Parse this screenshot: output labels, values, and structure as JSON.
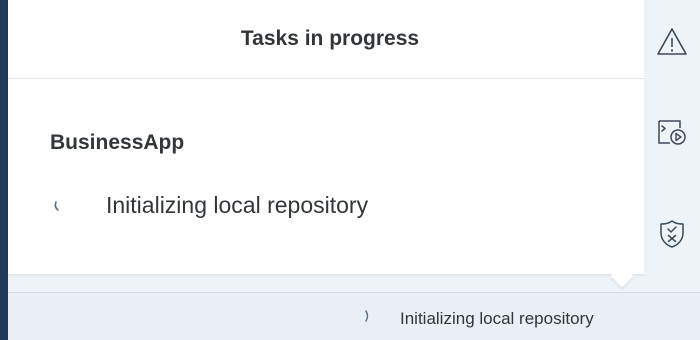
{
  "popover": {
    "title": "Tasks in progress",
    "app_name": "BusinessApp",
    "task_text": "Initializing local repository"
  },
  "status_bar": {
    "text": "Initializing local repository"
  },
  "right_rail": {
    "buttons": [
      {
        "icon": "warning-icon"
      },
      {
        "icon": "terminal-run-icon"
      },
      {
        "icon": "shield-check-icon"
      }
    ]
  },
  "colors": {
    "text": "#32363a",
    "rail_bg": "#eef3f8",
    "status_bg": "#e9eff5",
    "left_border": "#1f3a5a",
    "icon": "#3b4a5a"
  }
}
